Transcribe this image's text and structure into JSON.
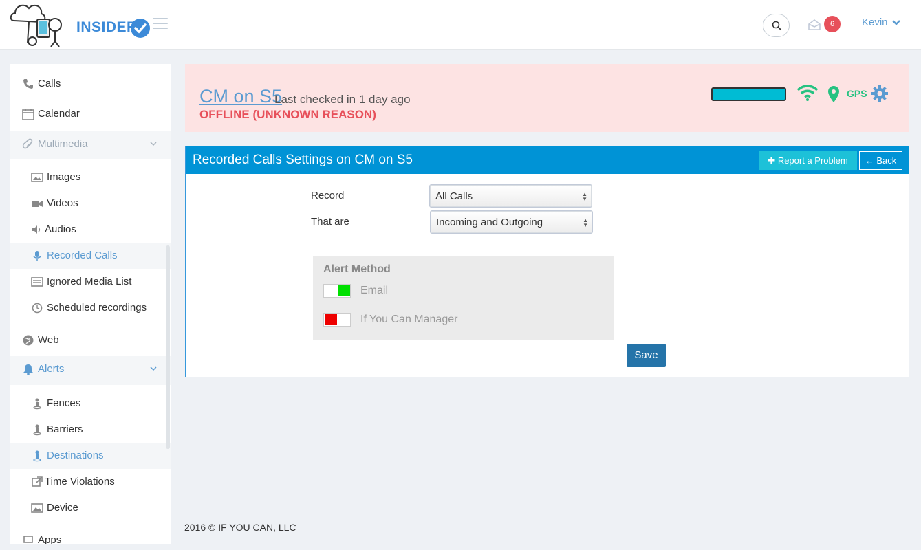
{
  "brand": {
    "name": "INSIDER",
    "accent": "#3c8ad8"
  },
  "header": {
    "notification_count": "6",
    "user_name": "Kevin",
    "icons": [
      "menu-icon",
      "search-icon",
      "inbox-icon",
      "chevron-down-icon"
    ]
  },
  "sidebar": {
    "items": [
      {
        "label": "Calls",
        "icon": "phone-icon"
      },
      {
        "label": "Calendar",
        "icon": "calendar-icon"
      },
      {
        "label": "Multimedia",
        "icon": "paperclip-icon",
        "expanded": true
      },
      {
        "label": "Images",
        "icon": "image-icon"
      },
      {
        "label": "Videos",
        "icon": "video-camera-icon"
      },
      {
        "label": "Audios",
        "icon": "speaker-icon"
      },
      {
        "label": "Recorded Calls",
        "icon": "microphone-icon",
        "active": true
      },
      {
        "label": "Ignored Media List",
        "icon": "list-icon"
      },
      {
        "label": "Scheduled recordings",
        "icon": "clock-icon"
      },
      {
        "label": "Web",
        "icon": "globe-icon"
      },
      {
        "label": "Alerts",
        "icon": "bell-icon",
        "expanded": true
      },
      {
        "label": "Fences",
        "icon": "person-pin-icon"
      },
      {
        "label": "Barriers",
        "icon": "person-pin-icon"
      },
      {
        "label": "Destinations",
        "icon": "person-pin-icon"
      },
      {
        "label": "Time Violations",
        "icon": "external-link-icon"
      },
      {
        "label": "Device",
        "icon": "image-icon"
      },
      {
        "label": "Apps",
        "icon": "laptop-icon"
      }
    ]
  },
  "device_status": {
    "device_name": "CM on S5",
    "last_checked": "Last checked in 1 day ago",
    "status": "OFFLINE (UNKNOWN REASON)",
    "gps_label": "GPS",
    "battery_color": "#00bcd4",
    "status_color": "#e7505a"
  },
  "settings": {
    "title": "Recorded Calls Settings on CM on S5",
    "report_button": "Report a Problem",
    "back_button": "Back",
    "record_label": "Record",
    "record_value": "All Calls",
    "that_are_label": "That are",
    "that_are_value": "Incoming and Outgoing",
    "alert_method_title": "Alert Method",
    "alert_methods": [
      {
        "label": "Email",
        "enabled": true
      },
      {
        "label": "If You Can Manager",
        "enabled": false
      }
    ],
    "save_button": "Save"
  },
  "footer": {
    "text": "2016 © IF YOU CAN, LLC"
  }
}
